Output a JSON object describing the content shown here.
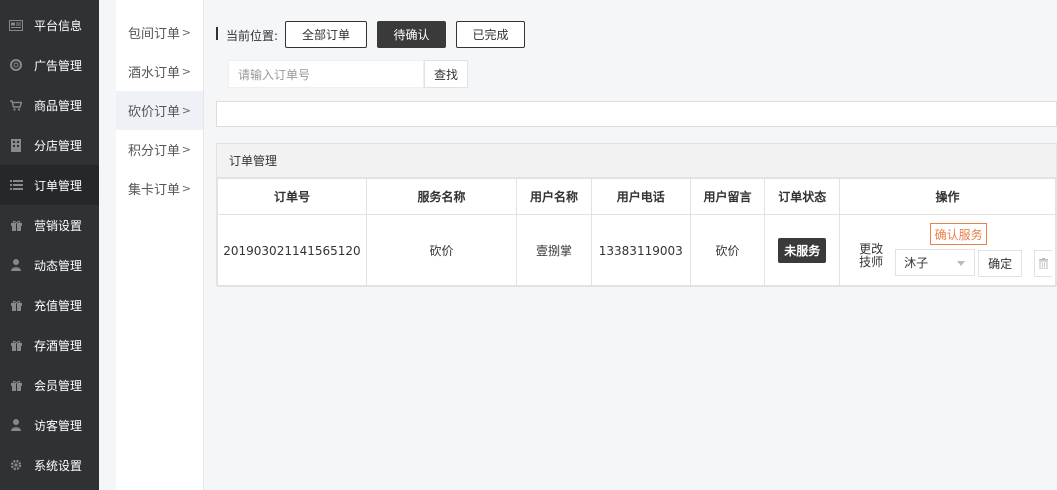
{
  "sidebar": {
    "items": [
      {
        "icon": "news-icon",
        "label": "平台信息"
      },
      {
        "icon": "lifebuoy-icon",
        "label": "广告管理"
      },
      {
        "icon": "cart-icon",
        "label": "商品管理"
      },
      {
        "icon": "building-icon",
        "label": "分店管理"
      },
      {
        "icon": "list-icon",
        "label": "订单管理"
      },
      {
        "icon": "gift-icon",
        "label": "营销设置"
      },
      {
        "icon": "user-icon",
        "label": "动态管理"
      },
      {
        "icon": "gift-icon",
        "label": "充值管理"
      },
      {
        "icon": "gift-icon",
        "label": "存酒管理"
      },
      {
        "icon": "gift-icon",
        "label": "会员管理"
      },
      {
        "icon": "user-icon",
        "label": "访客管理"
      },
      {
        "icon": "gear-icon",
        "label": "系统设置"
      }
    ]
  },
  "subnav": {
    "items": [
      {
        "label": "包间订单",
        "chevron": ">"
      },
      {
        "label": "酒水订单",
        "chevron": ">"
      },
      {
        "label": "砍价订单",
        "chevron": ">"
      },
      {
        "label": "积分订单",
        "chevron": ">"
      },
      {
        "label": "集卡订单",
        "chevron": ">"
      }
    ]
  },
  "toolbar": {
    "location_label": "当前位置:",
    "filters": [
      {
        "label": "全部订单"
      },
      {
        "label": "待确认"
      },
      {
        "label": "已完成"
      }
    ]
  },
  "search": {
    "placeholder": "请输入订单号",
    "button": "查找"
  },
  "panel": {
    "title": "订单管理",
    "columns": [
      "订单号",
      "服务名称",
      "用户名称",
      "用户电话",
      "用户留言",
      "订单状态",
      "操作"
    ],
    "row": {
      "order_no": "201903021141565120",
      "service": "砍价",
      "user_name": "壹捌掌",
      "phone": "13383119003",
      "message": "砍价",
      "status": "未服务",
      "actions": {
        "confirm_service": "确认服务",
        "change_tech_line1": "更改",
        "change_tech_line2": "技师",
        "tech_selected": "沐子",
        "confirm": "确定"
      }
    }
  },
  "colors": {
    "sidebar_bg": "#2f3133",
    "active_bg": "#25272a",
    "accent_orange": "#e7814c",
    "badge_dark": "#3a3a3a"
  }
}
